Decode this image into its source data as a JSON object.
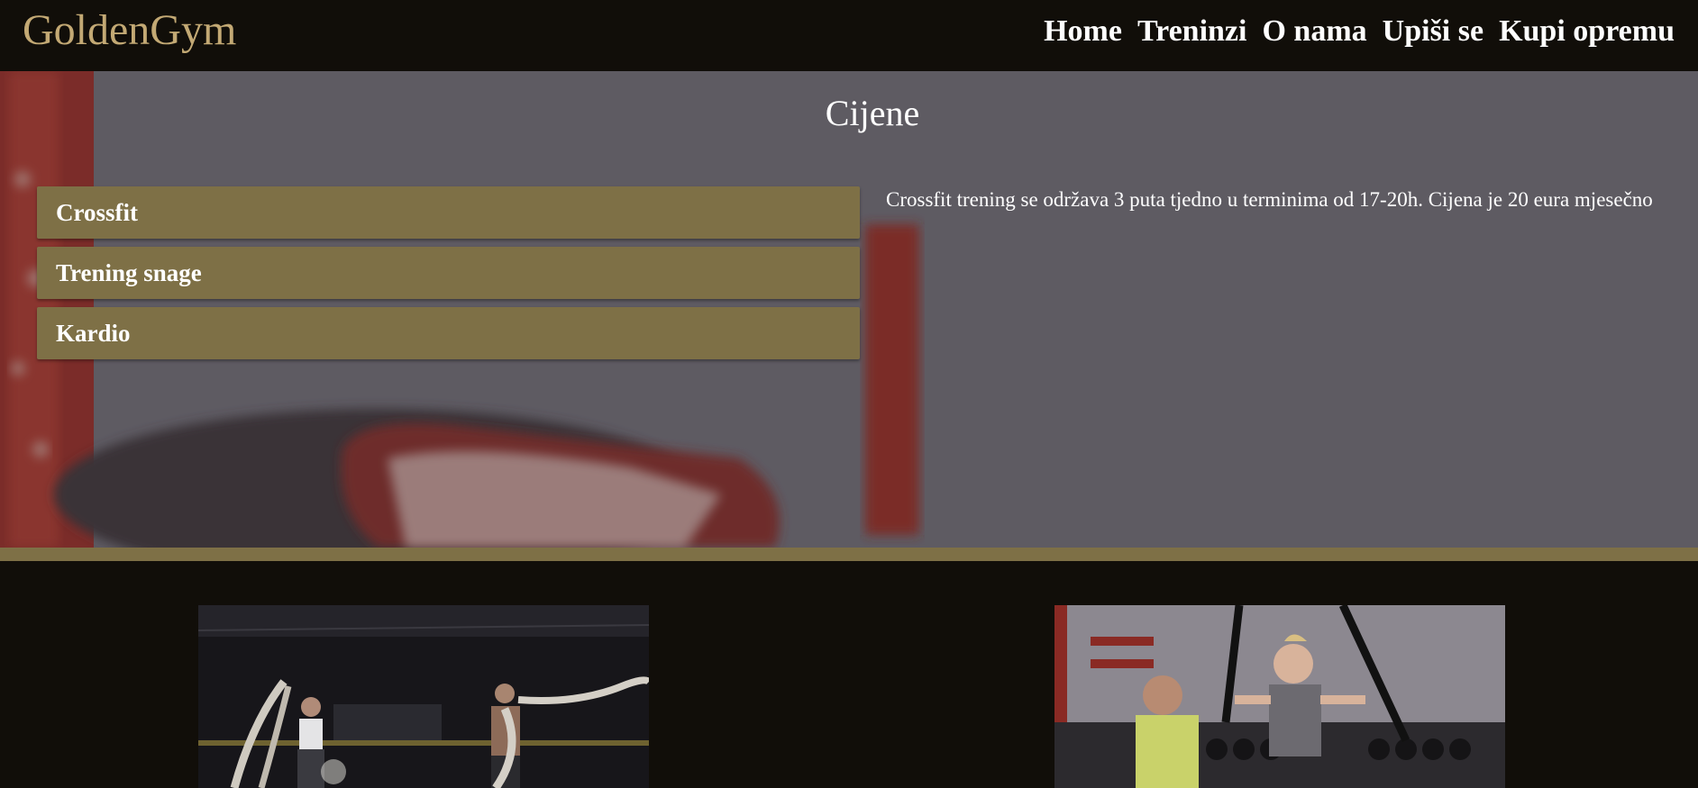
{
  "header": {
    "logo": "GoldenGym",
    "nav": [
      "Home",
      "Treninzi",
      "O nama",
      "Upiši se",
      "Kupi opremu"
    ]
  },
  "pricing": {
    "title": "Cijene",
    "items": [
      "Crossfit",
      "Trening snage",
      "Kardio"
    ],
    "description": "Crossfit trening se održava 3 puta tjedno u terminima od 17-20h. Cijena je 20 eura mjesečno"
  },
  "images": {
    "left": "battle-ropes-training-photo",
    "right": "trx-suspension-training-photo"
  },
  "colors": {
    "background": "#110e09",
    "accent_gold": "#7e7046",
    "logo_gold": "#c3a974",
    "text": "#ffffff"
  }
}
